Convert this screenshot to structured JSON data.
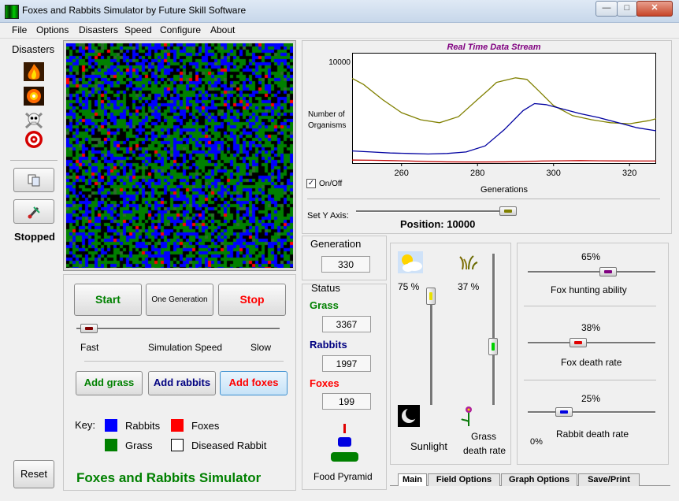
{
  "window": {
    "title": "Foxes and Rabbits Simulator by Future Skill Software"
  },
  "menu": [
    "File",
    "Options",
    "Disasters",
    "Speed",
    "Configure",
    "About"
  ],
  "left": {
    "disasters_label": "Disasters",
    "status": "Stopped",
    "reset_label": "Reset"
  },
  "controls": {
    "start": "Start",
    "one_generation": "One Generation",
    "stop": "Stop",
    "speed_fast": "Fast",
    "speed_label": "Simulation Speed",
    "speed_slow": "Slow",
    "speed_value": 0.02,
    "add_grass": "Add grass",
    "add_rabbits": "Add rabbits",
    "add_foxes": "Add foxes"
  },
  "key": {
    "label": "Key:",
    "items": [
      {
        "name": "Rabbits",
        "color": "#0000ff"
      },
      {
        "name": "Foxes",
        "color": "#ff0000"
      },
      {
        "name": "Grass",
        "color": "#008000"
      },
      {
        "name": "Diseased Rabbit",
        "color": "#ffffff"
      }
    ]
  },
  "app_name": "Foxes and Rabbits Simulator",
  "graph": {
    "title": "Real Time Data Stream",
    "ylabel_1": "Number of",
    "ylabel_2": "Organisms",
    "xlabel": "Generations",
    "onoff_label": "On/Off",
    "onoff_checked": true,
    "set_y_label": "Set Y Axis:",
    "position_label": "Position: 10000",
    "y_slider_value": 1.0
  },
  "chart_data": {
    "type": "line",
    "x_range": [
      247,
      327
    ],
    "ylim": [
      0,
      10000
    ],
    "y_ticks": [
      "10000"
    ],
    "x_ticks": [
      260,
      280,
      300,
      320
    ],
    "series": [
      {
        "color": "#808000",
        "x": [
          247,
          250,
          255,
          260,
          265,
          270,
          275,
          280,
          283,
          285,
          290,
          293,
          296,
          300,
          305,
          310,
          315,
          320,
          325,
          327
        ],
        "y": [
          8400,
          7800,
          6300,
          5000,
          4300,
          4000,
          4600,
          6300,
          7300,
          8000,
          8450,
          8300,
          7200,
          5700,
          4700,
          4300,
          4000,
          3900,
          4200,
          4400
        ]
      },
      {
        "color": "#0000a0",
        "x": [
          247,
          252,
          257,
          262,
          267,
          272,
          277,
          282,
          287,
          292,
          295,
          298,
          302,
          307,
          312,
          317,
          322,
          327
        ],
        "y": [
          1200,
          1100,
          1000,
          950,
          900,
          950,
          1100,
          1700,
          3300,
          5200,
          5900,
          5800,
          5400,
          4900,
          4500,
          4000,
          3500,
          3200
        ]
      },
      {
        "color": "#c00000",
        "x": [
          247,
          252,
          257,
          262,
          267,
          272,
          277,
          282,
          287,
          292,
          297,
          302,
          307,
          312,
          317,
          322,
          327
        ],
        "y": [
          300,
          280,
          250,
          200,
          150,
          120,
          110,
          110,
          120,
          150,
          200,
          230,
          250,
          230,
          210,
          200,
          200
        ]
      }
    ]
  },
  "generation": {
    "label": "Generation",
    "value": "330"
  },
  "status_panel": {
    "label": "Status",
    "grass_label": "Grass",
    "grass_value": "3367",
    "rabbits_label": "Rabbits",
    "rabbits_value": "1997",
    "foxes_label": "Foxes",
    "foxes_value": "199",
    "pyramid_label": "Food Pyramid"
  },
  "environment": {
    "sunlight_percent": "75  %",
    "sunlight_label": "Sunlight",
    "sunlight_value": 0.75,
    "grass_death_percent": "37  %",
    "grass_death_label_1": "Grass",
    "grass_death_label_2": "death rate",
    "grass_death_value": 0.37
  },
  "rates": {
    "fox_hunting_percent": "65%",
    "fox_hunting_label": "Fox hunting ability",
    "fox_hunting_value": 0.65,
    "fox_death_percent": "38%",
    "fox_death_label": "Fox death rate",
    "fox_death_value": 0.38,
    "rabbit_death_percent": "25%",
    "rabbit_death_label": "Rabbit death rate",
    "rabbit_death_value": 0.25,
    "zero_label": "0%"
  },
  "tabs": [
    "Main",
    "Field Options",
    "Graph Options",
    "Save/Print"
  ],
  "colors": {
    "green": "#008000",
    "red": "#ff0000",
    "blue": "#000080",
    "title_purple": "#800080",
    "fox": "#ff0000",
    "rabbit": "#0000ff",
    "grass": "#008000"
  }
}
